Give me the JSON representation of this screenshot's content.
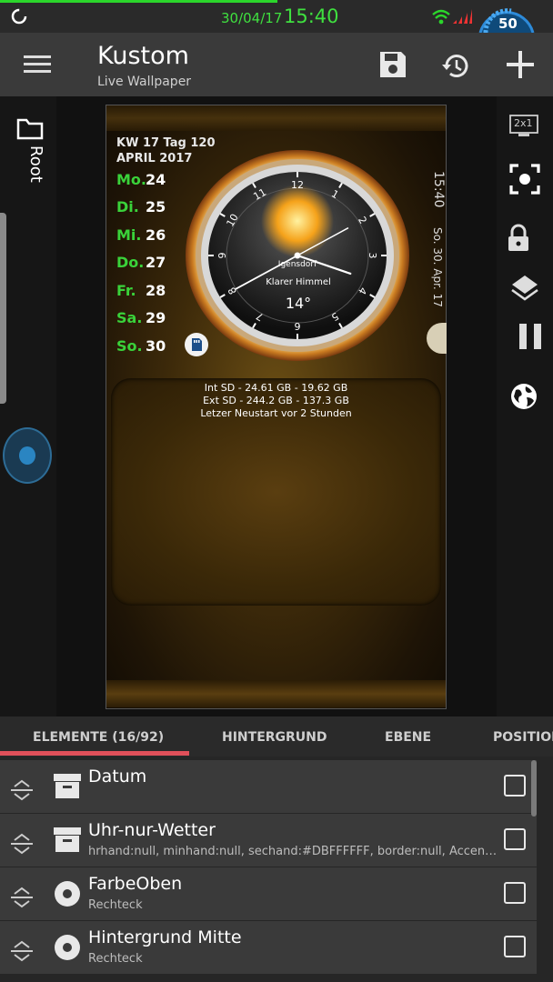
{
  "status_bar": {
    "date": "30/04/17",
    "time": "15:40",
    "battery_level": "50",
    "colors": {
      "text": "#3fe03f",
      "progress": "#2bd62b"
    }
  },
  "toolbar": {
    "title": "Kustom",
    "subtitle": "Live Wallpaper",
    "icons": [
      "menu-icon",
      "save-icon",
      "history-icon",
      "add-icon"
    ]
  },
  "left_rail": {
    "root_label": "Root"
  },
  "right_rail": {
    "size_badge": "2x1"
  },
  "preview": {
    "calendar": {
      "week_line": "KW 17 Tag 120",
      "month_line": "APRIL 2017",
      "days": [
        {
          "name": "Mo.",
          "num": "24"
        },
        {
          "name": "Di.",
          "num": "25"
        },
        {
          "name": "Mi.",
          "num": "26"
        },
        {
          "name": "Do.",
          "num": "27"
        },
        {
          "name": "Fr.",
          "num": "28"
        },
        {
          "name": "Sa.",
          "num": "29"
        },
        {
          "name": "So.",
          "num": "30"
        }
      ]
    },
    "clock": {
      "numerals": [
        "12",
        "1",
        "2",
        "3",
        "4",
        "5",
        "6",
        "7",
        "8",
        "9",
        "10",
        "11"
      ],
      "location": "Igensdorf",
      "condition": "Klarer Himmel",
      "temperature": "14°",
      "hour": 15,
      "minute": 40
    },
    "vertical_time": "15:40",
    "vertical_date": "So. 30. Apr. 17",
    "storage": {
      "int_sd": "Int SD - 24.61 GB - 19.62 GB",
      "ext_sd": "Ext SD - 244.2 GB - 137.3 GB",
      "restart": "Letzer Neustart vor 2 Stunden"
    }
  },
  "tabs": [
    {
      "label": "ELEMENTE (16/92)"
    },
    {
      "label": "HINTERGRUND"
    },
    {
      "label": "EBENE"
    },
    {
      "label": "POSITION"
    }
  ],
  "items": [
    {
      "title": "Datum",
      "subtitle": ""
    },
    {
      "title": "Uhr-nur-Wetter",
      "subtitle": "hrhand:null, minhand:null, sechand:#DBFFFFFF, border:null, Accent:#..."
    },
    {
      "title": "FarbeOben",
      "subtitle": "Rechteck"
    },
    {
      "title": "Hintergrund Mitte",
      "subtitle": "Rechteck"
    }
  ]
}
